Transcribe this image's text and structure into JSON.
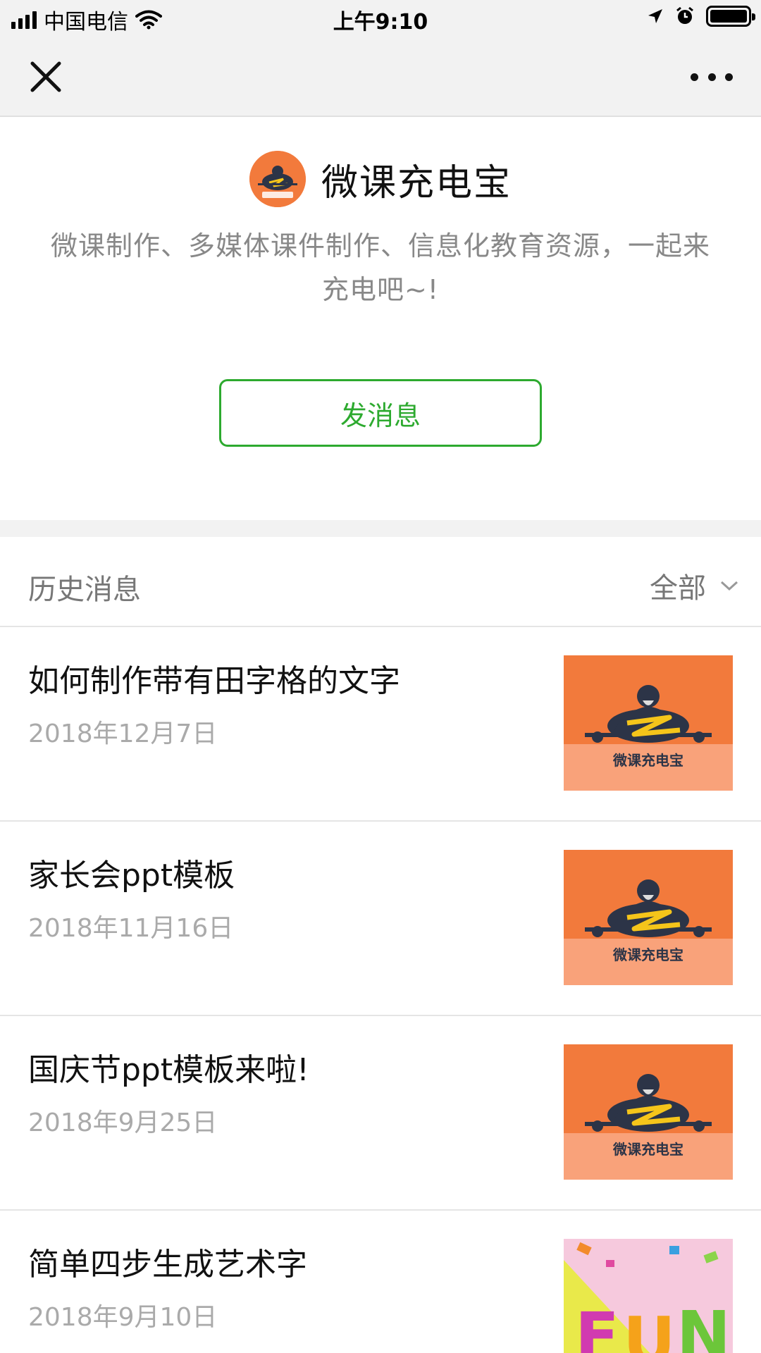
{
  "status_bar": {
    "carrier": "中国电信",
    "time": "上午9:10"
  },
  "nav": {
    "close_icon": "close-icon",
    "more_icon": "more-icon"
  },
  "profile": {
    "name": "微课充电宝",
    "description": "微课制作、多媒体课件制作、信息化教育资源，一起来充电吧~!",
    "send_button": "发消息",
    "logo_text": "微课充电宝"
  },
  "history": {
    "label": "历史消息",
    "filter": "全部"
  },
  "articles": [
    {
      "title": "如何制作带有田字格的文字",
      "date": "2018年12月7日",
      "thumb": "logo"
    },
    {
      "title": "家长会ppt模板",
      "date": "2018年11月16日",
      "thumb": "logo"
    },
    {
      "title": "国庆节ppt模板来啦!",
      "date": "2018年9月25日",
      "thumb": "logo"
    },
    {
      "title": "简单四步生成艺术字",
      "date": "2018年9月10日",
      "thumb": "fun"
    }
  ],
  "colors": {
    "accent_green": "#2daa2f",
    "logo_orange": "#f27a3c",
    "logo_peach": "#f9a27a",
    "logo_navy": "#2c3447"
  }
}
